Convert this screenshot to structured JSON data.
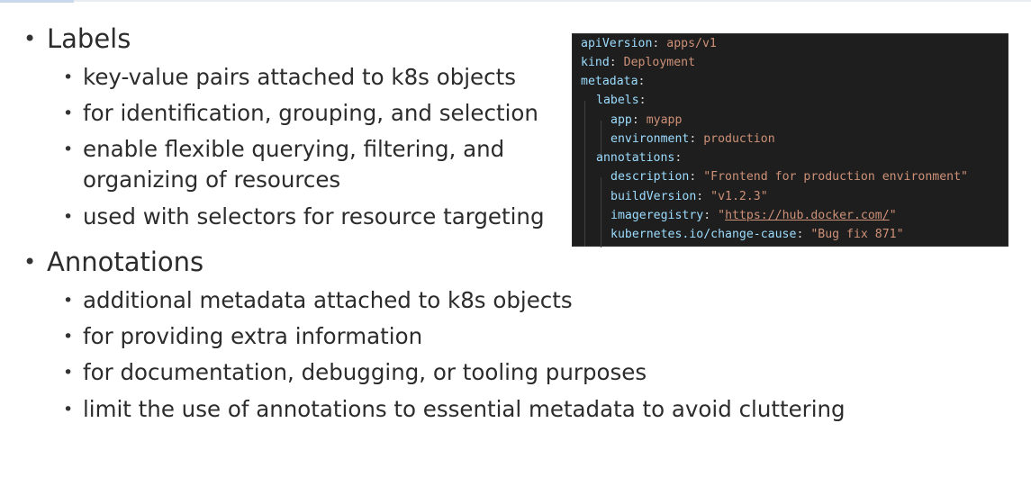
{
  "labels_section": {
    "title": "Labels",
    "points": [
      "key-value pairs attached to k8s objects",
      "for identification, grouping, and selection",
      "enable flexible querying, filtering, and organizing of resources",
      "used with selectors for resource targeting"
    ]
  },
  "annotations_section": {
    "title": "Annotations",
    "points": [
      "additional metadata attached to k8s objects",
      "for providing extra information",
      "for documentation, debugging, or tooling purposes",
      "limit the use of annotations to essential metadata to avoid cluttering"
    ]
  },
  "yaml": {
    "apiVersion_key": "apiVersion",
    "apiVersion_value": "apps/v1",
    "kind_key": "kind",
    "kind_value": "Deployment",
    "metadata_key": "metadata",
    "labels_key": "labels",
    "app_key": "app",
    "app_value": "myapp",
    "environment_key": "environment",
    "environment_value": "production",
    "annotations_key": "annotations",
    "description_key": "description",
    "description_value": "\"Frontend for production environment\"",
    "buildVersion_key": "buildVersion",
    "buildVersion_value": "\"v1.2.3\"",
    "imageregistry_key": "imageregistry",
    "imageregistry_url": "https://hub.docker.com/",
    "change_cause_key": "kubernetes.io/change-cause",
    "change_cause_value": "\"Bug fix 871\"",
    "colors": {
      "background": "#1e1e1e",
      "key": "#9cdcfe",
      "value": "#ce9178",
      "punctuation": "#d4d4d4"
    }
  }
}
